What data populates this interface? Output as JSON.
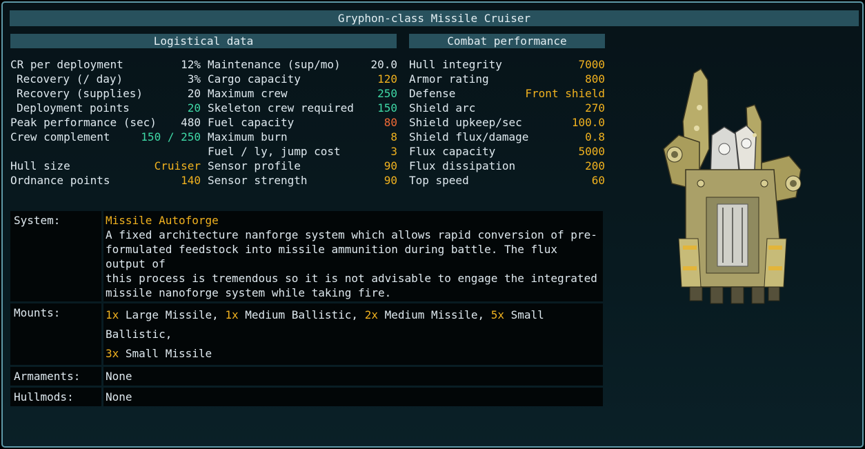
{
  "title": "Gryphon-class Missile Cruiser",
  "headers": {
    "logistical": "Logistical data",
    "combat": "Combat performance"
  },
  "col_a": [
    {
      "label": "CR per deployment",
      "value": "12%",
      "color": "white",
      "indent": false
    },
    {
      "label": "Recovery (/ day)",
      "value": "3%",
      "color": "white",
      "indent": true
    },
    {
      "label": "Recovery (supplies)",
      "value": "20",
      "color": "white",
      "indent": true
    },
    {
      "label": "Deployment points",
      "value": "20",
      "color": "teal",
      "indent": true
    },
    {
      "label": "Peak performance (sec)",
      "value": "480",
      "color": "white",
      "indent": false
    },
    {
      "label": "Crew complement",
      "value": "150 / 250",
      "color": "teal",
      "indent": false
    },
    {
      "label": "",
      "value": "",
      "color": "white",
      "indent": false
    },
    {
      "label": "Hull size",
      "value": "Cruiser",
      "color": "gold",
      "indent": false
    },
    {
      "label": "Ordnance points",
      "value": "140",
      "color": "gold",
      "indent": false
    }
  ],
  "col_b": [
    {
      "label": "Maintenance (sup/mo)",
      "value": "20.0",
      "color": "white",
      "indent": false
    },
    {
      "label": "Cargo capacity",
      "value": "120",
      "color": "gold",
      "indent": false
    },
    {
      "label": "Maximum crew",
      "value": "250",
      "color": "teal",
      "indent": false
    },
    {
      "label": "Skeleton crew required",
      "value": "150",
      "color": "teal",
      "indent": false
    },
    {
      "label": "Fuel capacity",
      "value": "80",
      "color": "red",
      "indent": false
    },
    {
      "label": "Maximum burn",
      "value": "8",
      "color": "gold",
      "indent": false
    },
    {
      "label": "Fuel / ly, jump cost",
      "value": "3",
      "color": "gold",
      "indent": false
    },
    {
      "label": "Sensor profile",
      "value": "90",
      "color": "gold",
      "indent": false
    },
    {
      "label": "Sensor strength",
      "value": "90",
      "color": "gold",
      "indent": false
    }
  ],
  "col_c": [
    {
      "label": "Hull integrity",
      "value": "7000",
      "color": "gold",
      "indent": false
    },
    {
      "label": "Armor rating",
      "value": "800",
      "color": "gold",
      "indent": false
    },
    {
      "label": "Defense",
      "value": "Front shield",
      "color": "gold",
      "indent": false
    },
    {
      "label": "Shield arc",
      "value": "270",
      "color": "gold",
      "indent": false
    },
    {
      "label": "Shield upkeep/sec",
      "value": "100.0",
      "color": "gold",
      "indent": false
    },
    {
      "label": "Shield flux/damage",
      "value": "0.8",
      "color": "gold",
      "indent": false
    },
    {
      "label": "Flux capacity",
      "value": "5000",
      "color": "gold",
      "indent": false
    },
    {
      "label": "Flux dissipation",
      "value": "200",
      "color": "gold",
      "indent": false
    },
    {
      "label": "Top speed",
      "value": "60",
      "color": "gold",
      "indent": false
    }
  ],
  "info": {
    "system_label": "System:",
    "system_name": "Missile Autoforge",
    "system_desc": "A fixed architecture nanforge system which allows rapid conversion of pre-formulated feedstock into missile ammunition during battle. The flux output of this process is tremendous so it is not advisable to engage the integrated missile nanoforge system while taking fire.",
    "system_desc_lines": [
      "A fixed architecture nanforge system which allows rapid conversion of pre-",
      "formulated feedstock into missile ammunition during battle. The flux output of",
      "this process is tremendous so it is not advisable to engage the integrated",
      "missile nanoforge system while taking fire."
    ],
    "mounts_label": "Mounts:",
    "mounts": [
      {
        "count": "1x",
        "name": "Large Missile",
        "sep": ", "
      },
      {
        "count": "1x",
        "name": "Medium Ballistic",
        "sep": ", "
      },
      {
        "count": "2x",
        "name": "Medium Missile",
        "sep": ", "
      },
      {
        "count": "5x",
        "name": "Small Ballistic",
        "sep": ","
      },
      {
        "count": "3x",
        "name": "Small Missile",
        "sep": ""
      }
    ],
    "armaments_label": "Armaments:",
    "armaments_value": "None",
    "hullmods_label": "Hullmods:",
    "hullmods_value": "None"
  },
  "ship_icon": "gryphon-ship-sprite"
}
